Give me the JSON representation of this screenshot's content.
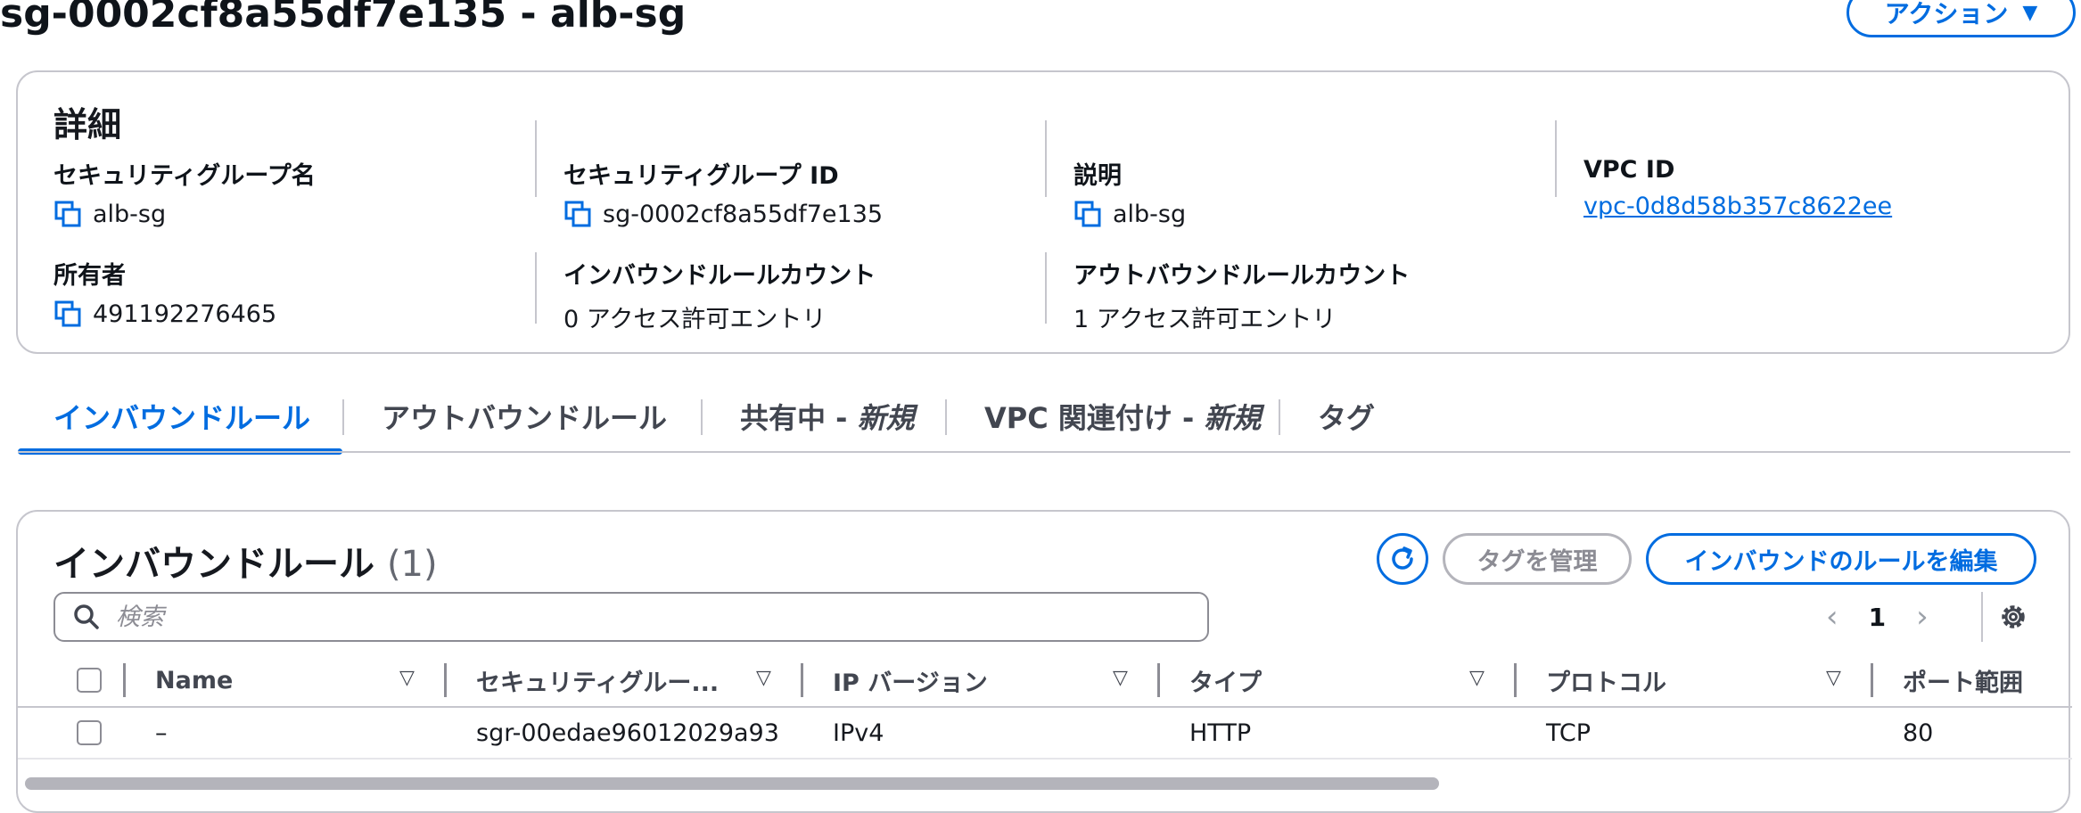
{
  "page": {
    "title": "sg-0002cf8a55df7e135 - alb-sg",
    "actions_label": "アクション"
  },
  "details": {
    "heading": "詳細",
    "fields": {
      "sg_name": {
        "label": "セキュリティグループ名",
        "value": "alb-sg"
      },
      "sg_id": {
        "label": "セキュリティグループ ID",
        "value": "sg-0002cf8a55df7e135"
      },
      "description": {
        "label": "説明",
        "value": "alb-sg"
      },
      "vpc_id": {
        "label": "VPC ID",
        "value": "vpc-0d8d58b357c8622ee"
      },
      "owner": {
        "label": "所有者",
        "value": "491192276465"
      },
      "inbound_count": {
        "label": "インバウンドルールカウント",
        "value": "0 アクセス許可エントリ"
      },
      "outbound_count": {
        "label": "アウトバウンドルールカウント",
        "value": "1 アクセス許可エントリ"
      }
    }
  },
  "tabs": [
    {
      "label": "インバウンドルール",
      "badge": "",
      "active": true
    },
    {
      "label": "アウトバウンドルール",
      "badge": "",
      "active": false
    },
    {
      "label": "共有中 - ",
      "badge": "新規",
      "active": false
    },
    {
      "label": "VPC 関連付け - ",
      "badge": "新規",
      "active": false
    },
    {
      "label": "タグ",
      "badge": "",
      "active": false
    }
  ],
  "rules": {
    "heading": "インバウンドルール",
    "count": "(1)",
    "manage_tags_label": "タグを管理",
    "edit_label": "インバウンドのルールを編集",
    "search_placeholder": "検索",
    "page_number": "1",
    "columns": [
      "Name",
      "セキュリティグルー...",
      "IP バージョン",
      "タイプ",
      "プロトコル",
      "ポート範囲"
    ],
    "rows": [
      [
        "–",
        "sgr-00edae96012029a93",
        "IPv4",
        "HTTP",
        "TCP",
        "80"
      ]
    ]
  },
  "colors": {
    "accent": "#006ce0",
    "border": "#c6c6cd",
    "disabled": "#8c8c94"
  },
  "icons": [
    "copy-icon",
    "caret-down-icon",
    "refresh-icon",
    "search-icon",
    "chevron-left-icon",
    "chevron-right-icon",
    "gear-icon",
    "sort-icon"
  ]
}
